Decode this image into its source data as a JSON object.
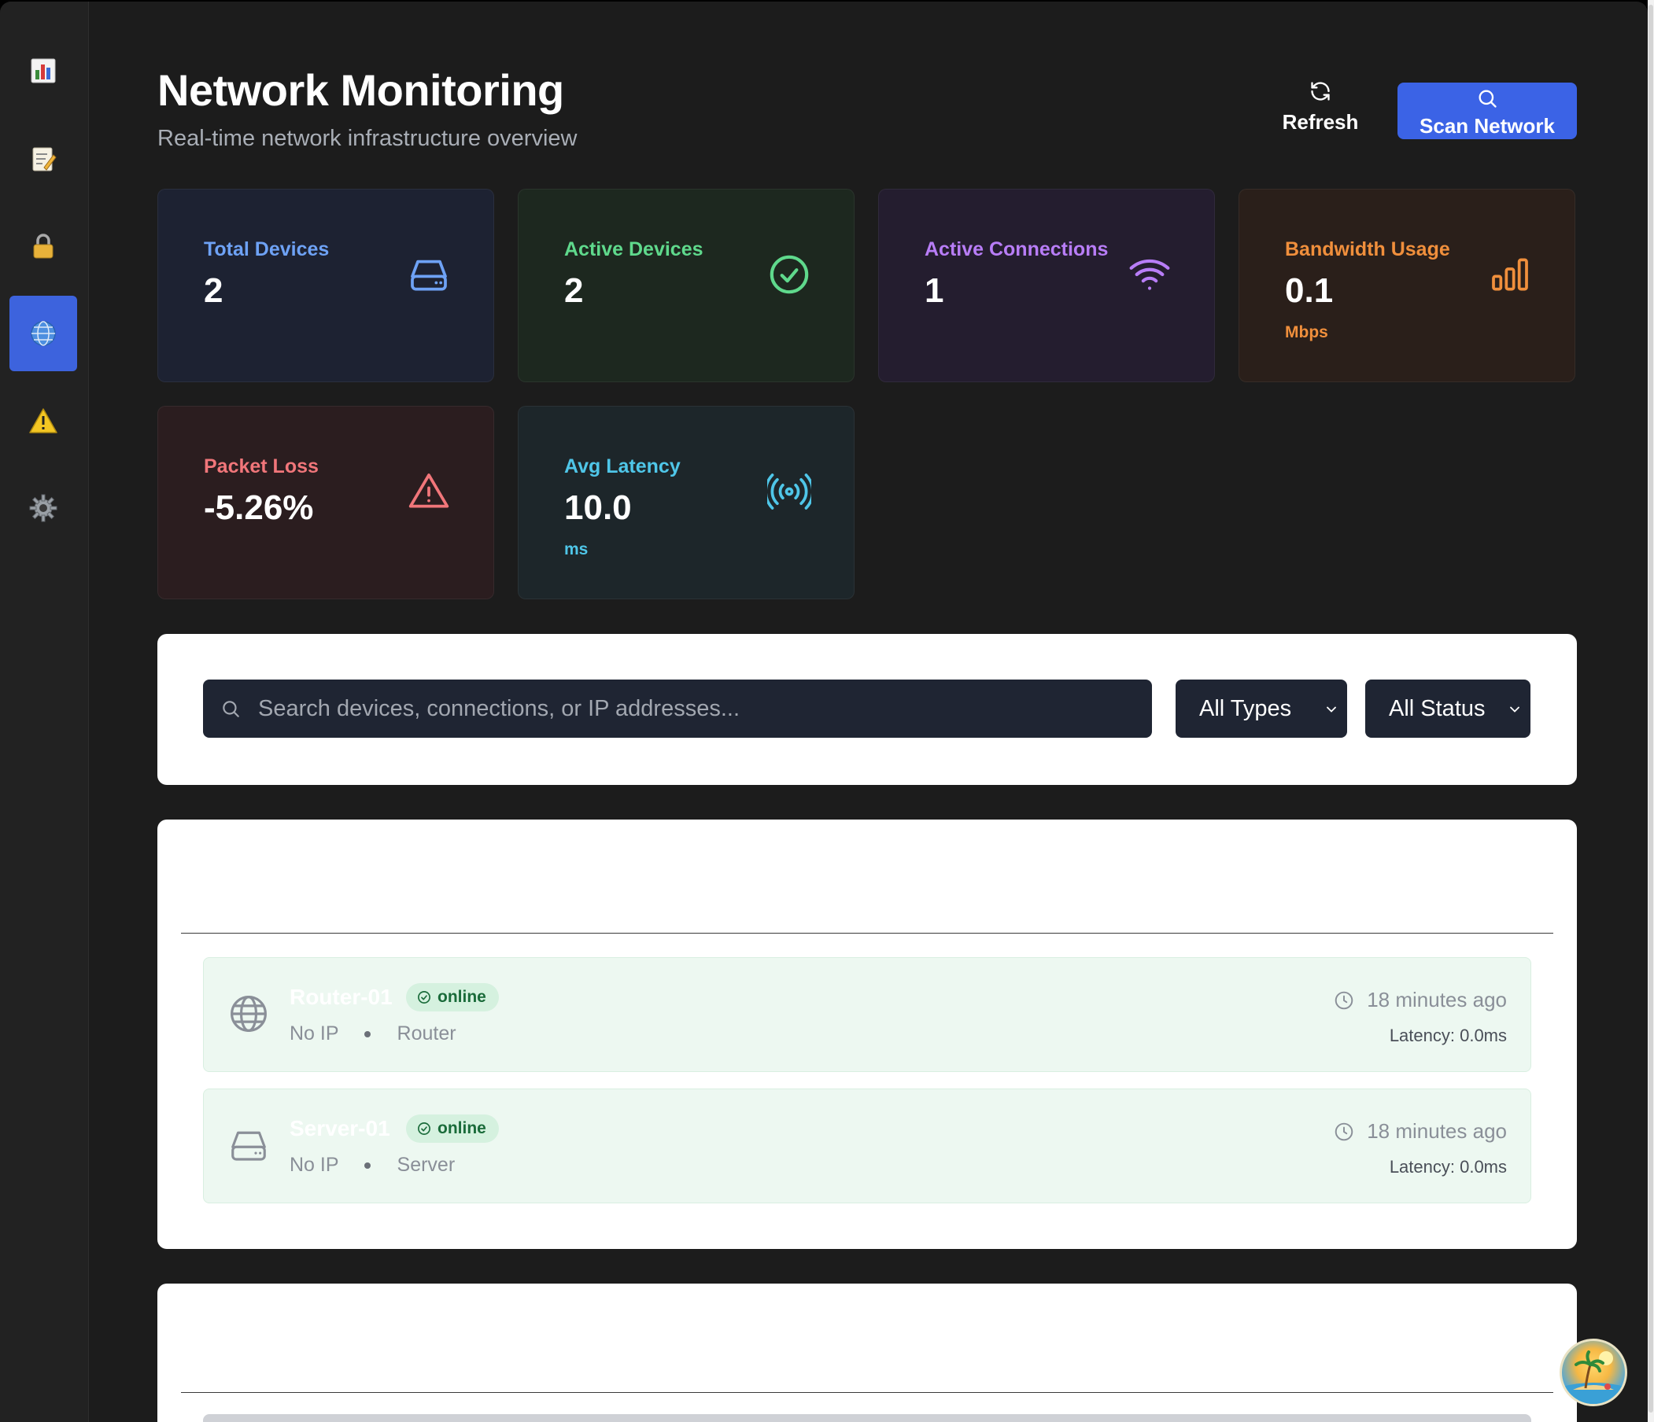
{
  "sidebar": {
    "items": [
      {
        "name": "dashboard",
        "icon": "bar-chart-icon",
        "active": false
      },
      {
        "name": "logs",
        "icon": "memo-icon",
        "active": false
      },
      {
        "name": "security",
        "icon": "lock-icon",
        "active": false
      },
      {
        "name": "network",
        "icon": "globe-icon",
        "active": true
      },
      {
        "name": "alerts",
        "icon": "warning-icon",
        "active": false
      },
      {
        "name": "settings",
        "icon": "gear-icon",
        "active": false
      }
    ]
  },
  "header": {
    "title": "Network Monitoring",
    "subtitle": "Real-time network infrastructure overview",
    "refresh_label": "Refresh",
    "scan_label": "Scan Network"
  },
  "stats": {
    "total_devices": {
      "label": "Total Devices",
      "value": "2",
      "icon": "server-icon"
    },
    "active_devices": {
      "label": "Active Devices",
      "value": "2",
      "icon": "check-circle-icon"
    },
    "active_connections": {
      "label": "Active Connections",
      "value": "1",
      "icon": "wifi-icon"
    },
    "bandwidth": {
      "label": "Bandwidth Usage",
      "value": "0.1",
      "unit": "Mbps",
      "icon": "signal-bars-icon"
    },
    "packet_loss": {
      "label": "Packet Loss",
      "value": "-5.26%",
      "icon": "alert-triangle-icon"
    },
    "latency": {
      "label": "Avg Latency",
      "value": "10.0",
      "unit": "ms",
      "icon": "radio-waves-icon"
    }
  },
  "filters": {
    "search_placeholder": "Search devices, connections, or IP addresses...",
    "type_selected": "All Types",
    "status_selected": "All Status"
  },
  "devices": [
    {
      "name": "Router-01",
      "status": "online",
      "ip": "No IP",
      "type": "Router",
      "last_seen": "18 minutes ago",
      "latency": "Latency: 0.0ms",
      "icon": "globe-icon"
    },
    {
      "name": "Server-01",
      "status": "online",
      "ip": "No IP",
      "type": "Server",
      "last_seen": "18 minutes ago",
      "latency": "Latency: 0.0ms",
      "icon": "server-icon"
    }
  ],
  "colors": {
    "accent": "#3b63e6",
    "background": "#1c1c1c",
    "online_badge_bg": "#d5f1df",
    "online_badge_text": "#1a6b3a"
  }
}
